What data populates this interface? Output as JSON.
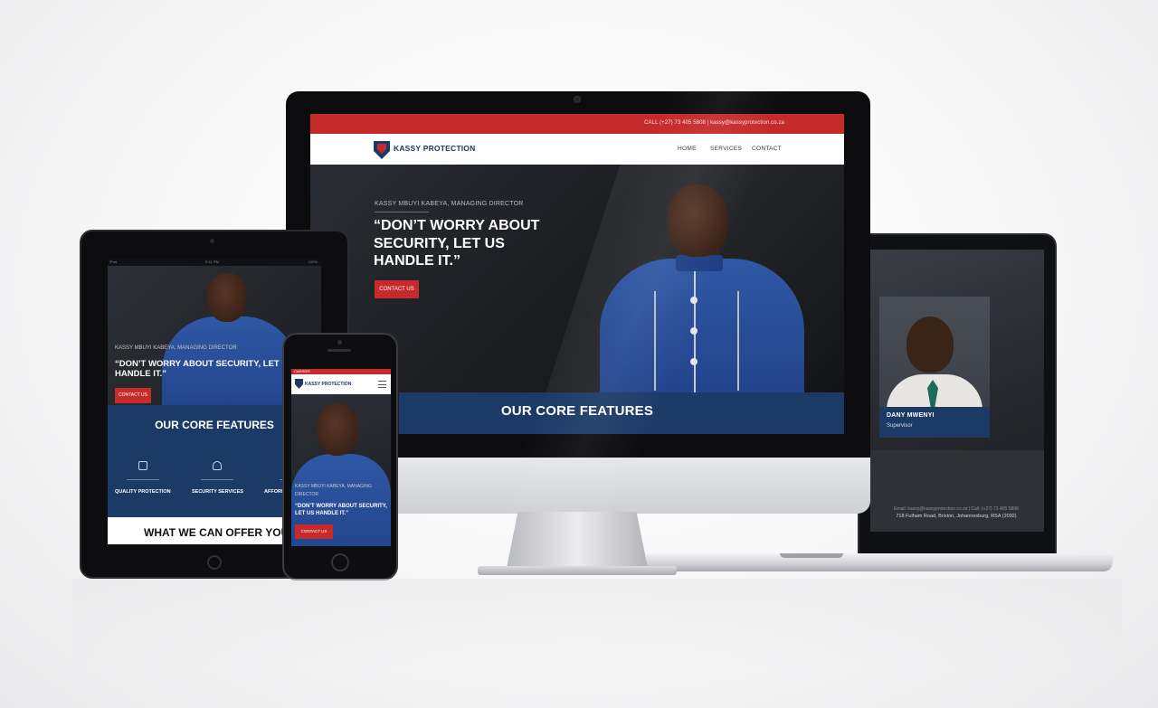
{
  "brand": {
    "name": "KASSY PROTECTION",
    "accent_red": "#c62a2a",
    "navy": "#1b3a66"
  },
  "desktop": {
    "topbar_contact": "CALL (+27) 73 405 5808 | kassy@kassyprotection.co.za",
    "nav": {
      "home": "HOME",
      "services": "SERVICES",
      "contact": "CONTACT"
    },
    "hero": {
      "subtitle": "KASSY MBUYI KABEYA, MANAGING DIRECTOR",
      "quote": "“DON’T WORRY ABOUT SECURITY, LET US HANDLE IT.”",
      "button": "CONTACT US"
    },
    "features_title": "OUR CORE FEATURES"
  },
  "laptop": {
    "team_member": {
      "name": "DANY MWENYI",
      "role": "Supervisor"
    },
    "footer": {
      "email_line": "Email: kassy@kassyprotection.co.za | Call: (+27) 73 405 5808",
      "address": "718 Fulham Road, Brixton, Johannesburg, RSA (2092)"
    }
  },
  "tablet": {
    "status": {
      "left": "iPad",
      "center": "9:41 PM",
      "right": "100%"
    },
    "hero": {
      "subtitle": "KASSY MBUYI KABEYA, MANAGING DIRECTOR",
      "quote": "“DON’T WORRY ABOUT SECURITY, LET US HANDLE IT.”",
      "button": "CONTACT US"
    },
    "features_title": "OUR CORE FEATURES",
    "features": [
      {
        "label": "QUALITY PROTECTION",
        "icon": "shield-icon"
      },
      {
        "label": "SECURITY SERVICES",
        "icon": "user-icon"
      },
      {
        "label": "AFFORDABLE",
        "icon": "tag-icon"
      }
    ],
    "offer_title": "WHAT WE CAN OFFER YOU"
  },
  "phone": {
    "status": "CARRIER",
    "logo": "KASSY PROTECTION",
    "hero": {
      "subtitle": "KASSY MBUYI KABEYA, MANAGING DIRECTOR",
      "quote": "“DON’T WORRY ABOUT SECURITY, LET US HANDLE IT.”",
      "button": "CONTACT US"
    }
  }
}
